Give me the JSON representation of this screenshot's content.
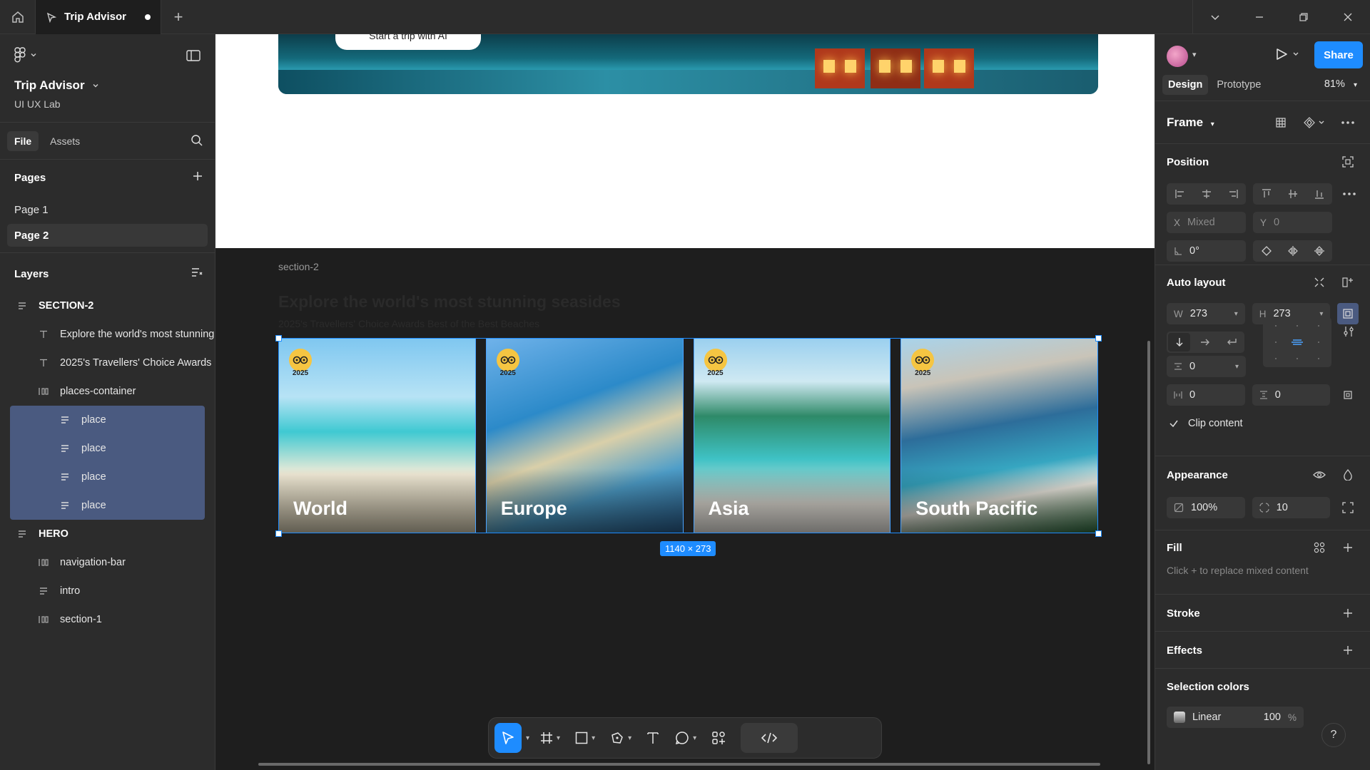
{
  "titlebar": {
    "tab_title": "Trip Advisor",
    "new_tab": "+"
  },
  "left_panel": {
    "project_name": "Trip Advisor",
    "team_name": "UI UX Lab",
    "tabs": [
      "File",
      "Assets"
    ],
    "pages_label": "Pages",
    "pages": [
      "Page 1",
      "Page 2"
    ],
    "layers_label": "Layers",
    "layers": [
      {
        "label": "SECTION-2",
        "type": "frame",
        "level": 0
      },
      {
        "label": "Explore the world's most stunning",
        "type": "text",
        "level": 1
      },
      {
        "label": "2025's Travellers' Choice Awards",
        "type": "text",
        "level": 1
      },
      {
        "label": "places-container",
        "type": "autolayout",
        "level": 1
      },
      {
        "label": "place",
        "type": "frame",
        "level": 2,
        "selected": true
      },
      {
        "label": "place",
        "type": "frame",
        "level": 2,
        "selected": true
      },
      {
        "label": "place",
        "type": "frame",
        "level": 2,
        "selected": true
      },
      {
        "label": "place",
        "type": "frame",
        "level": 2,
        "selected": true
      },
      {
        "label": "HERO",
        "type": "frame",
        "level": 0
      },
      {
        "label": "navigation-bar",
        "type": "autolayout",
        "level": 1
      },
      {
        "label": "intro",
        "type": "frame",
        "level": 1
      },
      {
        "label": "section-1",
        "type": "autolayout",
        "level": 1
      }
    ]
  },
  "canvas": {
    "hero_button": "Start a trip with AI",
    "section_label": "section-2",
    "section_title": "Explore the world's most stunning seasides",
    "section_subtitle": "2025's Travellers' Choice Awards Best of the Best Beaches",
    "badge_year": "2025",
    "places": [
      "World",
      "Europe",
      "Asia",
      "South Pacific"
    ],
    "selection_size": "1140 × 273"
  },
  "right_panel": {
    "share_label": "Share",
    "tabs": [
      "Design",
      "Prototype"
    ],
    "zoom": "81%",
    "frame_label": "Frame",
    "position_label": "Position",
    "x_label": "X",
    "x_value": "Mixed",
    "y_label": "Y",
    "y_value": "0",
    "rotation": "0°",
    "auto_layout_label": "Auto layout",
    "w_label": "W",
    "w_value": "273",
    "h_label": "H",
    "h_value": "273",
    "gap_value": "0",
    "padding_h": "0",
    "padding_v": "0",
    "clip_content": "Clip content",
    "appearance_label": "Appearance",
    "opacity": "100%",
    "radius": "10",
    "fill_label": "Fill",
    "fill_hint": "Click + to replace mixed content",
    "stroke_label": "Stroke",
    "effects_label": "Effects",
    "selection_colors_label": "Selection colors",
    "selection_color_name": "Linear",
    "selection_color_opacity": "100",
    "percent": "%"
  },
  "colors": {
    "accent": "#1e8cff",
    "panel": "#2c2c2c",
    "canvas": "#1e1e1e",
    "selected_layer": "#4a5a80"
  }
}
